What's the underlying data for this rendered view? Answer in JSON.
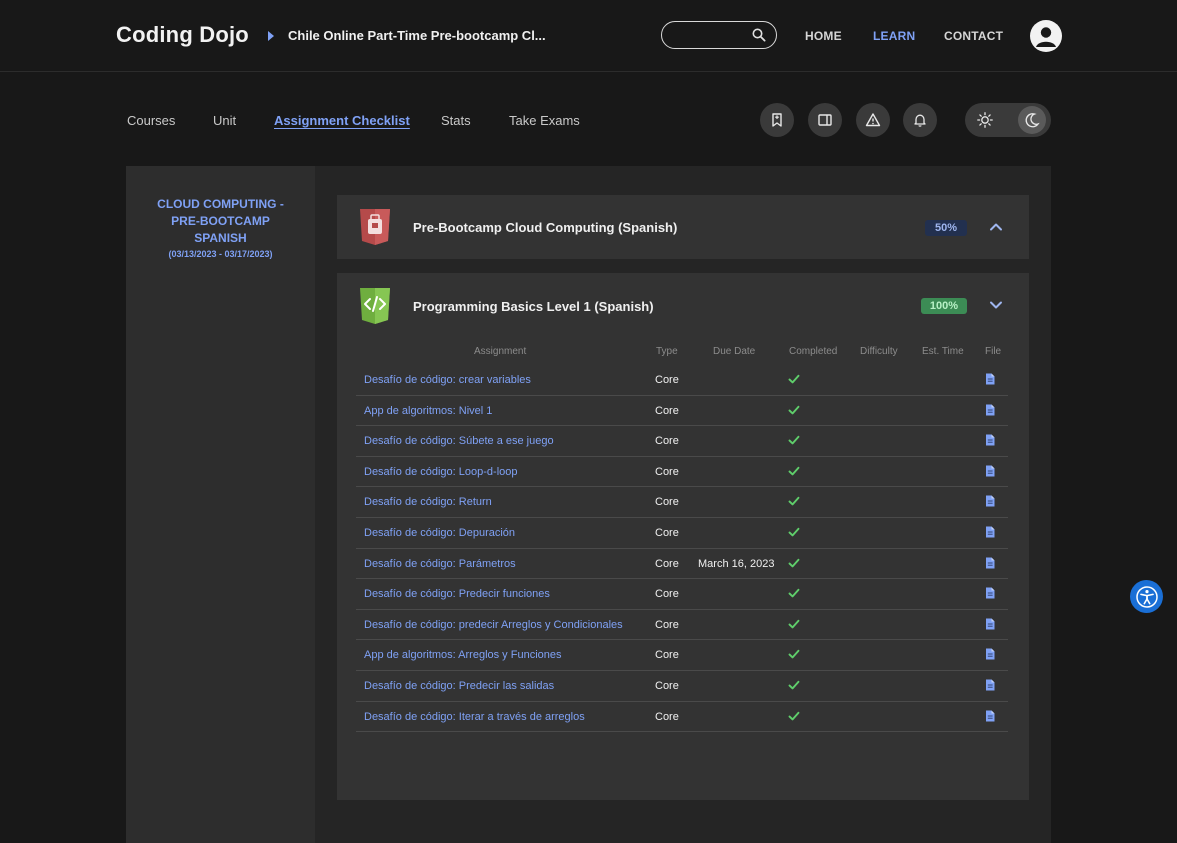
{
  "header": {
    "logo": "Coding Dojo",
    "breadcrumb": "Chile Online Part-Time Pre-bootcamp Cl...",
    "search": {
      "placeholder": "",
      "value": ""
    },
    "nav": {
      "home": "HOME",
      "learn": "LEARN",
      "contact": "CONTACT"
    },
    "active_nav": "LEARN"
  },
  "subnav": {
    "items": [
      "Courses",
      "Unit",
      "Assignment Checklist",
      "Stats",
      "Take Exams"
    ],
    "active": "Assignment Checklist"
  },
  "toolbar_icons": [
    "bookmark-icon",
    "book-icon",
    "alert-icon",
    "bell-icon"
  ],
  "theme_toggle": {
    "options": [
      "sun-icon",
      "moon-icon"
    ],
    "selected": "moon-icon"
  },
  "sidebar": {
    "title": "CLOUD COMPUTING - PRE-BOOTCAMP SPANISH",
    "dates": "(03/13/2023 - 03/17/2023)"
  },
  "courses": [
    {
      "title": "Pre-Bootcamp Cloud Computing (Spanish)",
      "progress": "50%",
      "expanded": false
    },
    {
      "title": "Programming Basics Level 1 (Spanish)",
      "progress": "100%",
      "expanded": true
    }
  ],
  "table": {
    "headers": {
      "assignment": "Assignment",
      "type": "Type",
      "due_date": "Due Date",
      "completed": "Completed",
      "difficulty": "Difficulty",
      "est_time": "Est. Time",
      "file": "File"
    },
    "rows": [
      {
        "name": "Desafío de código: crear variables",
        "type": "Core",
        "due": "",
        "completed": true
      },
      {
        "name": "App de algoritmos: Nivel 1",
        "type": "Core",
        "due": "",
        "completed": true
      },
      {
        "name": "Desafío de código: Súbete a ese juego",
        "type": "Core",
        "due": "",
        "completed": true
      },
      {
        "name": "Desafío de código: Loop-d-loop",
        "type": "Core",
        "due": "",
        "completed": true
      },
      {
        "name": "Desafío de código: Return",
        "type": "Core",
        "due": "",
        "completed": true
      },
      {
        "name": "Desafío de código: Depuración",
        "type": "Core",
        "due": "",
        "completed": true
      },
      {
        "name": "Desafío de código: Parámetros",
        "type": "Core",
        "due": "March 16, 2023",
        "completed": true
      },
      {
        "name": "Desafío de código: Predecir funciones",
        "type": "Core",
        "due": "",
        "completed": true
      },
      {
        "name": "Desafío de código: predecir Arreglos y Condicionales",
        "type": "Core",
        "due": "",
        "completed": true
      },
      {
        "name": "App de algoritmos: Arreglos y Funciones",
        "type": "Core",
        "due": "",
        "completed": true
      },
      {
        "name": "Desafío de código: Predecir las salidas",
        "type": "Core",
        "due": "",
        "completed": true
      },
      {
        "name": "Desafío de código: Iterar a través de arreglos",
        "type": "Core",
        "due": "",
        "completed": true
      }
    ]
  },
  "colors": {
    "accent": "#7fa1f5",
    "success": "#5fce6b",
    "background": "#181818",
    "panel": "#333333"
  }
}
